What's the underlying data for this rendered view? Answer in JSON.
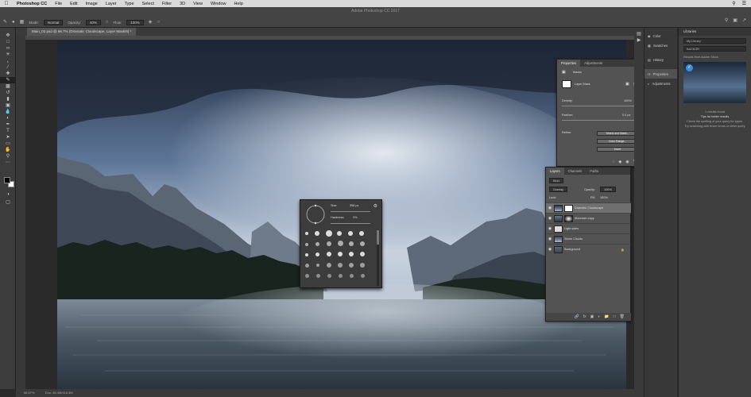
{
  "menubar": {
    "app_name": "Photoshop CC",
    "items": [
      "File",
      "Edit",
      "Image",
      "Layer",
      "Type",
      "Select",
      "Filter",
      "3D",
      "View",
      "Window",
      "Help"
    ]
  },
  "window": {
    "title": "Adobe Photoshop CC 2017"
  },
  "options": {
    "mode_label": "Mode:",
    "mode_value": "Normal",
    "opacity_label": "Opacity:",
    "opacity_value": "40%",
    "flow_label": "Flow:",
    "flow_value": "100%"
  },
  "document": {
    "tab_label": "Main_02.psd @ 66.7% (Dramatic Cloudscape, Layer Mask/8) *",
    "status": "66.67%",
    "doc_size": "Doc: 46.4M/316.3M"
  },
  "panel_strip": {
    "items": [
      "Color",
      "Swatches",
      "History",
      "Properties",
      "Adjustments"
    ],
    "active_index": 3
  },
  "libraries": {
    "header": "Libraries",
    "dropdown": "My Library",
    "search_value": "BACKGR",
    "results_title": "Results from Adobe Stock",
    "msg_1": "1 results found",
    "msg_2": "Tips for better results",
    "msg_3": "Check the spelling of your query for typos.",
    "msg_4": "Try searching with fewer terms or other query"
  },
  "properties": {
    "tabs": [
      "Properties",
      "Adjustments"
    ],
    "section": "Masks",
    "mask_label": "Layer Mask",
    "density_label": "Density:",
    "density_value": "100%",
    "feather_label": "Feather:",
    "feather_value": "0.0 px",
    "refine_label": "Refine:",
    "btn_select": "Select and Mask...",
    "btn_color": "Color Range...",
    "btn_invert": "Invert"
  },
  "layers": {
    "tabs": [
      "Layers",
      "Channels",
      "Paths"
    ],
    "kind": "Kind",
    "blend": "Overlay",
    "opacity_label": "Opacity:",
    "opacity_value": "100%",
    "lock_label": "Lock:",
    "fill_label": "Fill:",
    "fill_value": "100%",
    "rows": [
      {
        "name": "Dramatic Cloudscape",
        "selected": true
      },
      {
        "name": "Mountain copy",
        "selected": false
      },
      {
        "name": "Light sides",
        "selected": false
      },
      {
        "name": "Storm Clouds",
        "selected": false
      },
      {
        "name": "Background",
        "selected": false
      }
    ]
  },
  "brush_picker": {
    "size_label": "Size:",
    "size_value": "358 px",
    "hardness_label": "Hardness:",
    "hardness_value": "0%"
  },
  "colors": {
    "accent": "#3c8fd8",
    "selected_row": "#6f6f6f"
  }
}
